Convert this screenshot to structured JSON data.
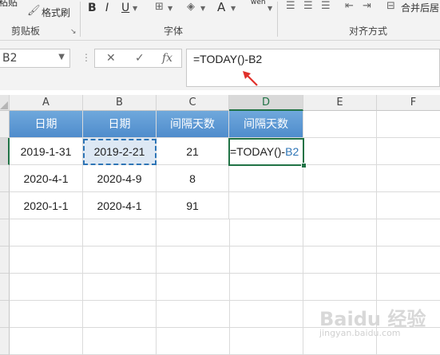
{
  "ribbon": {
    "paste_label": "粘贴",
    "format_painter_label": "格式刷",
    "clipboard_group": "剪贴板",
    "font_group": "字体",
    "alignment_group": "对齐方式",
    "merge_center_label": "合并后居",
    "bold_label": "B",
    "italic_label": "I",
    "underline_label": "U",
    "font_color_label": "A",
    "phonetic_label": "wén"
  },
  "formula_bar": {
    "name_box": "B2",
    "cancel_symbol": "✕",
    "enter_symbol": "✓",
    "fx_symbol": "fx",
    "formula": "=TODAY()-B2"
  },
  "columns": [
    "A",
    "B",
    "C",
    "D",
    "E",
    "F"
  ],
  "table": {
    "headers": [
      "日期",
      "日期",
      "间隔天数",
      "间隔天数"
    ],
    "rows": [
      [
        "2019-1-31",
        "2019-2-21",
        "21",
        ""
      ],
      [
        "2020-4-1",
        "2020-4-9",
        "8",
        ""
      ],
      [
        "2020-1-1",
        "2020-4-1",
        "91",
        ""
      ]
    ]
  },
  "active_cell": {
    "formula_prefix": "=TODAY()-",
    "formula_ref": "B2"
  },
  "watermark": {
    "brand": "Baidu 经验",
    "url": "jingyan.baidu.com"
  },
  "colors": {
    "header_fill": "#5b9bd5",
    "active_border": "#217346",
    "ref_blue": "#2e75b6",
    "arrow_red": "#e0302b"
  }
}
